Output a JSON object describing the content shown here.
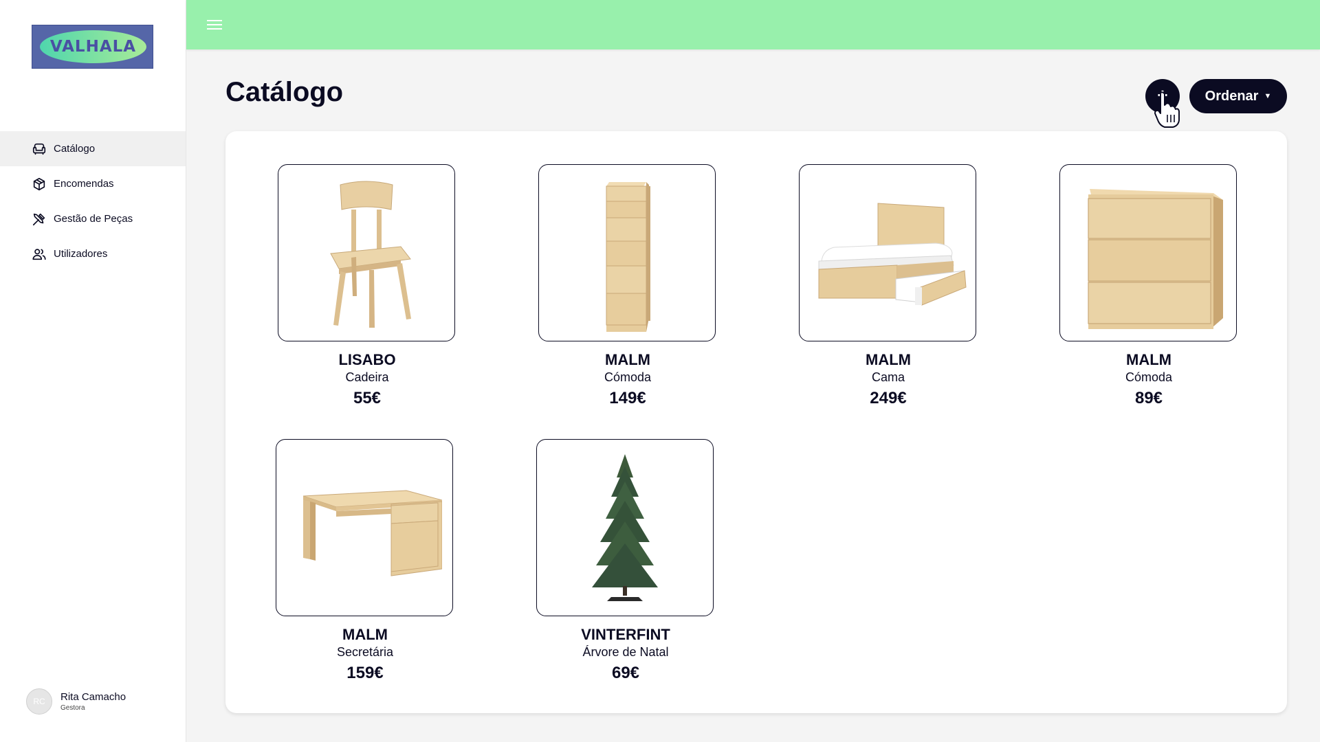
{
  "brand": {
    "logo_text": "VALHALA"
  },
  "sidebar": {
    "items": [
      {
        "label": "Catálogo",
        "icon": "sofa-icon",
        "active": true
      },
      {
        "label": "Encomendas",
        "icon": "package-icon",
        "active": false
      },
      {
        "label": "Gestão de Peças",
        "icon": "tools-icon",
        "active": false
      },
      {
        "label": "Utilizadores",
        "icon": "users-icon",
        "active": false
      }
    ]
  },
  "user": {
    "initials": "RC",
    "name": "Rita Camacho",
    "role": "Gestora"
  },
  "topbar": {
    "menu_icon": "hamburger-icon",
    "background": "#98f0ac"
  },
  "page": {
    "title": "Catálogo"
  },
  "actions": {
    "add_label": "+",
    "sort_label": "Ordenar",
    "sort_icon": "caret-down-icon"
  },
  "products": [
    {
      "name": "LISABO",
      "type": "Cadeira",
      "price": "55€",
      "image": "chair"
    },
    {
      "name": "MALM",
      "type": "Cómoda",
      "price": "149€",
      "image": "tall-dresser"
    },
    {
      "name": "MALM",
      "type": "Cama",
      "price": "249€",
      "image": "bed"
    },
    {
      "name": "MALM",
      "type": "Cómoda",
      "price": "89€",
      "image": "dresser"
    },
    {
      "name": "MALM",
      "type": "Secretária",
      "price": "159€",
      "image": "desk"
    },
    {
      "name": "VINTERFINT",
      "type": "Árvore de Natal",
      "price": "69€",
      "image": "christmas-tree"
    }
  ],
  "colors": {
    "primary": "#0b0b22",
    "accent": "#98f0ac",
    "wood": "#e3c99a"
  }
}
